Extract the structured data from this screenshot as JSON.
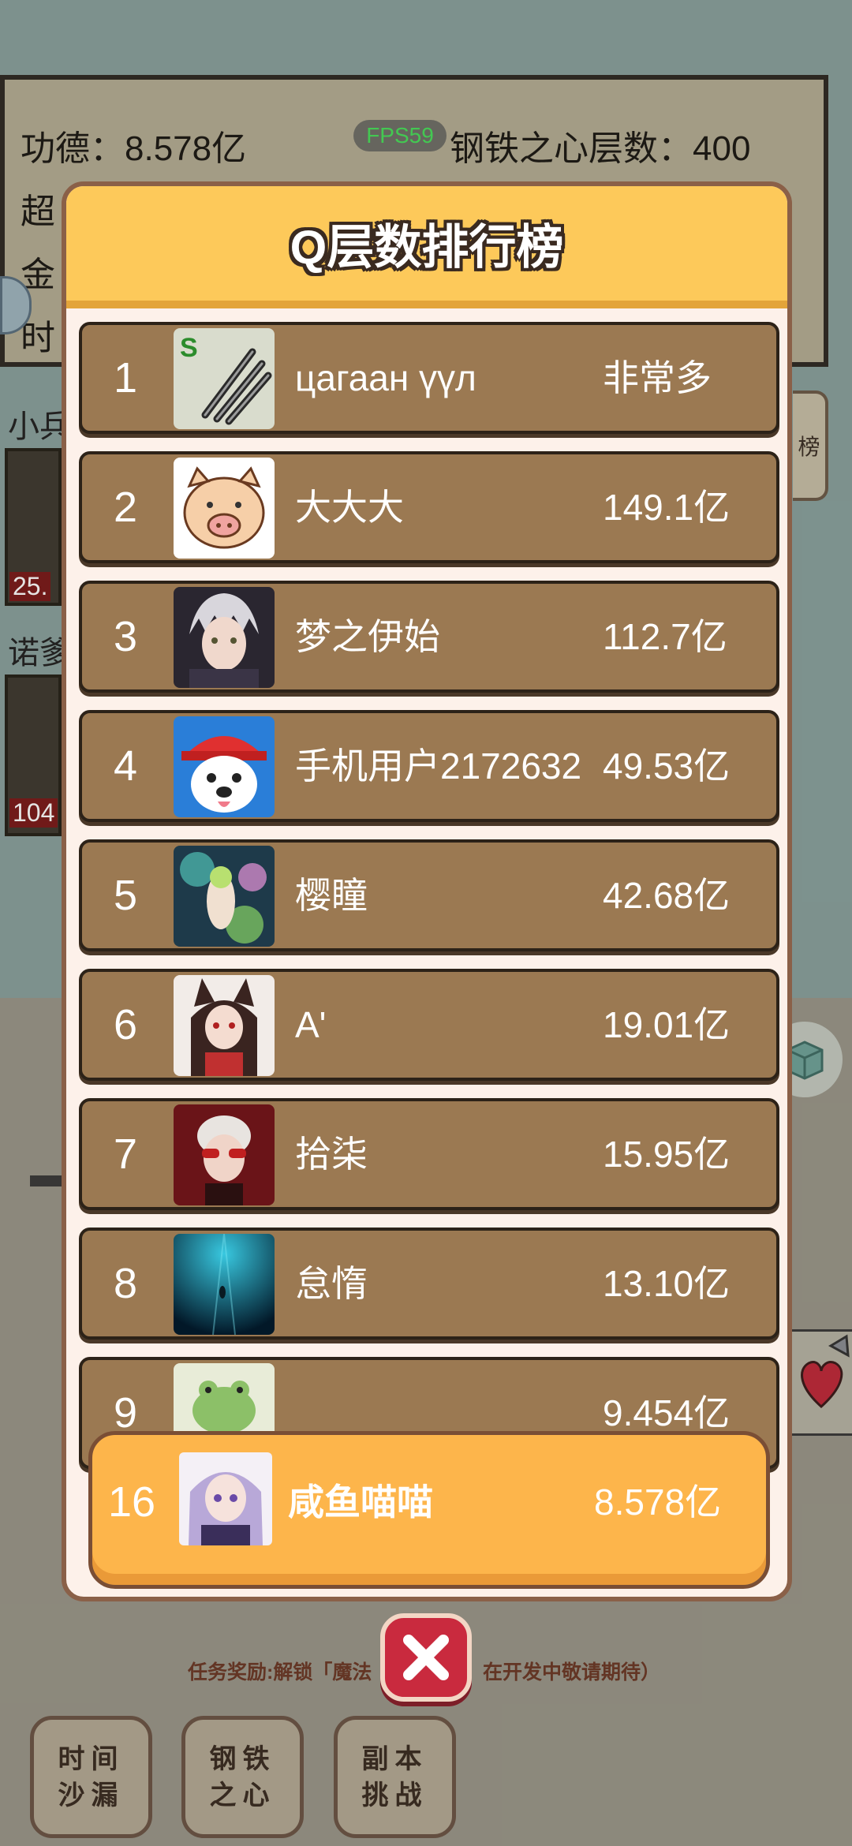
{
  "background": {
    "stats": {
      "merit": "功德：8.578亿",
      "steel_heart_layers": "钢铁之心层数：400",
      "fps": "FPS59",
      "line2_fragment": "超",
      "line3_fragment": "金",
      "line4_fragment": "时"
    },
    "side_labels": [
      "小兵",
      "诺爹"
    ],
    "side_numbers": [
      "25.",
      "104"
    ],
    "right_button_fragment": "榜",
    "task_reward_text": "任务奖励:解锁「魔法",
    "task_reward_tail": "在开发中敬请期待）",
    "bottom_buttons": [
      "时间沙漏",
      "钢铁之心",
      "副本挑战"
    ]
  },
  "leaderboard": {
    "title": "Q层数排行榜",
    "rows": [
      {
        "rank": "1",
        "name": "цагаан үүл",
        "score": "非常多",
        "avatar": "claw-skill-avatar"
      },
      {
        "rank": "2",
        "name": "大大大",
        "score": "149.1亿",
        "avatar": "pig-avatar"
      },
      {
        "rank": "3",
        "name": "梦之伊始",
        "score": "112.7亿",
        "avatar": "anime-silver-hair-avatar"
      },
      {
        "rank": "4",
        "name": "手机用户2172632",
        "score": "49.53亿",
        "avatar": "dog-firefighter-avatar"
      },
      {
        "rank": "5",
        "name": "樱瞳",
        "score": "42.68亿",
        "avatar": "fairy-art-avatar"
      },
      {
        "rank": "6",
        "name": "A'",
        "score": "19.01亿",
        "avatar": "fox-girl-avatar"
      },
      {
        "rank": "7",
        "name": "拾柒",
        "score": "15.95亿",
        "avatar": "red-glasses-avatar"
      },
      {
        "rank": "8",
        "name": "怠惰",
        "score": "13.10亿",
        "avatar": "underwater-avatar"
      },
      {
        "rank": "9",
        "name": "",
        "score": "9.454亿",
        "avatar": "frog-avatar"
      }
    ],
    "self": {
      "rank": "16",
      "name": "咸鱼喵喵",
      "score": "8.578亿",
      "avatar": "purple-hair-avatar"
    }
  },
  "colors": {
    "header": "#fdc95a",
    "row": "#9b7952",
    "self_row": "#fdb54b",
    "close": "#c92a3e"
  }
}
